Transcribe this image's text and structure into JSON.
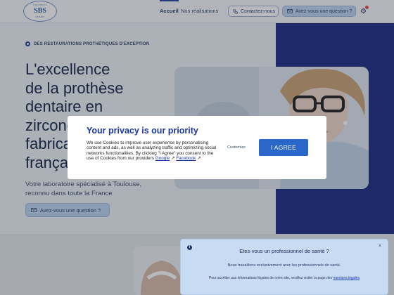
{
  "header": {
    "logo": {
      "top_text": "Laboratoire",
      "mark": "SBS",
      "bottom_text": "dentaire"
    },
    "nav": [
      {
        "label": "Accueil",
        "active": true
      },
      {
        "label": "Nos réalisations",
        "active": false
      }
    ],
    "contact_label": "Contactez-nous",
    "question_label": "Avez-vous une question ?",
    "settings_icon": "gear-icon"
  },
  "hero": {
    "eyebrow": "DES RESTAURATIONS PROTHÉTIQUES D'EXCEPTION",
    "title_lines": [
      "L'excellence",
      "de la prothèse",
      "dentaire en",
      "zircone et",
      "fabrication",
      "française"
    ],
    "subtitle_lines": [
      "Votre laboratoire spécialisé à Toulouse,",
      "reconnu dans toute la France"
    ],
    "cta_label": "Avez-vous une question ?"
  },
  "cookie_modal": {
    "title": "Your privacy is our priority",
    "body": "We use Cookies to improve user experience by personalising content and ads, as well as analyzing traffic and optimizing social networks functionalities. By clicking \"I Agree\" you consent to the use of Cookies from our providers",
    "link_google": "Google",
    "link_separator": " ",
    "link_facebook": "Facebook",
    "customize_label": "Customize",
    "agree_label": "I AGREE"
  },
  "notice": {
    "title": "Etes-vous un professionnel de santé ?",
    "line1": "Nous travaillons exclusivement avec les professionnels de santé.",
    "line2_prefix": "Pour accéder aux informations légales de notre site, veuillez visiter la page des",
    "line2_link": "mentions légales",
    "close_label": "×",
    "info_label": "i"
  },
  "colors": {
    "brand_navy": "#13237e",
    "accent_blue": "#2a67c9",
    "button_light": "#bcd4f0",
    "notice_bg": "#c7dcf3"
  }
}
